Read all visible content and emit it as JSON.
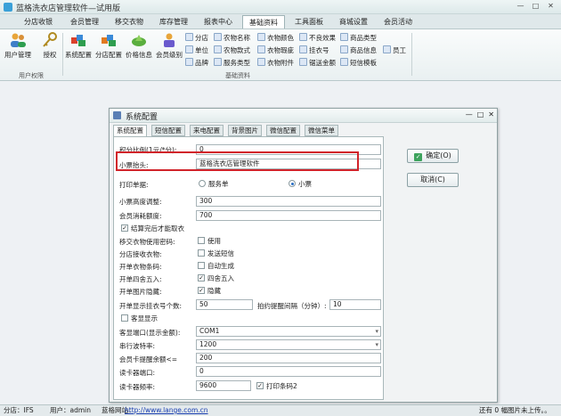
{
  "window": {
    "title": "蓝格洗衣店管理软件—试用版",
    "min": "—",
    "max": "□",
    "close": "✕"
  },
  "menu": [
    "分店收银",
    "会员管理",
    "移交衣物",
    "库存管理",
    "报表中心",
    "基础资料",
    "工具面板",
    "商城设置",
    "会员活动"
  ],
  "ribbon": {
    "group1": {
      "label": "用户权限",
      "buttons": [
        "用户管理",
        "授权"
      ]
    },
    "group2": {
      "label": "基础资料",
      "big_buttons": [
        "系统配置",
        "分店配置",
        "价格信息",
        "会员级别"
      ],
      "small_buttons": [
        [
          "分店",
          "农物名称",
          "衣物颜色",
          "不良效果",
          "商品类型"
        ],
        [
          "单位",
          "农物款式",
          "衣物瑕疵",
          "挂衣号",
          "商品信息",
          "员工"
        ],
        [
          "品牌",
          "服务类型",
          "衣物附件",
          "锯送金额",
          "短信模板"
        ]
      ]
    }
  },
  "dialog": {
    "title": "系统配置",
    "min": "—",
    "max": "□",
    "close": "✕",
    "tabs": [
      "系统配置",
      "短信配置",
      "来电配置",
      "背景图片",
      "微信配置",
      "微信菜单"
    ],
    "fields": {
      "points_label": "积分比例(1元/*分):",
      "points_value": "0",
      "receipt_header_label": "小票抬头:",
      "receipt_header_value": "蓝格洗衣店管理软件",
      "print_label": "打印单据:",
      "print_option1": "服务单",
      "print_option2": "小票",
      "receipt_height_label": "小票高度调整:",
      "receipt_height_value": "300",
      "member_limit_label": "会员消耗额度:",
      "member_limit_value": "700",
      "settle_label": "结算完后才能取衣",
      "transfer_pwd_label": "移交衣物使用密码:",
      "transfer_pwd_check": "使用",
      "branch_receive_label": "分店接收衣物:",
      "branch_receive_check": "发送短信",
      "order_code_label": "开单衣物条码:",
      "order_code_check": "自动生成",
      "rounding_label": "开单四舍五入:",
      "rounding_check": "四舍五入",
      "image_hide_label": "开单图片隐藏:",
      "image_hide_check": "隐藏",
      "hang_count_label": "开单显示挂衣号个数:",
      "hang_count_value": "50",
      "remind_label": "拍约提醒间隔（分钟）:",
      "remind_value": "10",
      "customer_display_label": "客显显示",
      "port_label": "客显端口(显示金额):",
      "port_value": "COM1",
      "baud_label": "串行波特率:",
      "baud_value": "1200",
      "card_remind_label": "会员卡提醒余额<=",
      "card_remind_value": "200",
      "reader_port_label": "读卡器端口:",
      "reader_port_value": "0",
      "reader_freq_label": "读卡器频率:",
      "reader_freq_value": "9600",
      "print_barcode_label": "打印条码2"
    },
    "ok": "确定(O)",
    "cancel": "取消(C)"
  },
  "status": {
    "branch": "分店：IFS",
    "user": "用户：admin",
    "site_label": "蓝格网站：",
    "site_url": "http://www.lange.com.cn",
    "uploads": "还有 0 幅图片未上传。。"
  }
}
